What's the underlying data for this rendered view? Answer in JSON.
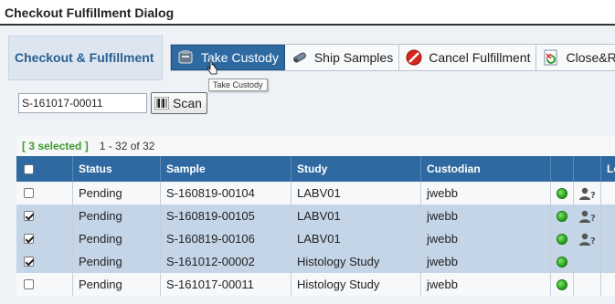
{
  "window": {
    "title": "Checkout Fulfillment Dialog"
  },
  "heading": "Checkout & Fulfillment",
  "toolbar": {
    "buttons": [
      {
        "label": "Take Custody",
        "icon": "take-custody-icon"
      },
      {
        "label": "Ship Samples",
        "icon": "ship-samples-icon"
      },
      {
        "label": "Cancel Fulfillment",
        "icon": "cancel-icon"
      },
      {
        "label": "Close&Refre",
        "icon": "close-refresh-icon"
      }
    ],
    "tooltip": "Take Custody"
  },
  "scan": {
    "value": "S-161017-00011",
    "button_label": "Scan"
  },
  "selection": {
    "count_label": "[ 3 selected ]",
    "paging": "1 - 32 of 32"
  },
  "grid": {
    "headers": [
      "Status",
      "Sample",
      "Study",
      "Custodian",
      "Lo"
    ],
    "rows": [
      {
        "checked": false,
        "status": "Pending",
        "sample": "S-160819-00104",
        "study": "LABV01",
        "custodian": "jwebb",
        "user_icon": true
      },
      {
        "checked": true,
        "status": "Pending",
        "sample": "S-160819-00105",
        "study": "LABV01",
        "custodian": "jwebb",
        "user_icon": true
      },
      {
        "checked": true,
        "status": "Pending",
        "sample": "S-160819-00106",
        "study": "LABV01",
        "custodian": "jwebb",
        "user_icon": true
      },
      {
        "checked": true,
        "status": "Pending",
        "sample": "S-161012-00002",
        "study": "Histology Study",
        "custodian": "jwebb",
        "user_icon": false
      },
      {
        "checked": false,
        "status": "Pending",
        "sample": "S-161017-00011",
        "study": "Histology Study",
        "custodian": "jwebb",
        "user_icon": false
      }
    ]
  },
  "colors": {
    "header_blue": "#2e6aa1",
    "selected_row": "#c4d5e8",
    "status_green": "#1f9a12",
    "selection_green": "#3f9a2b"
  }
}
